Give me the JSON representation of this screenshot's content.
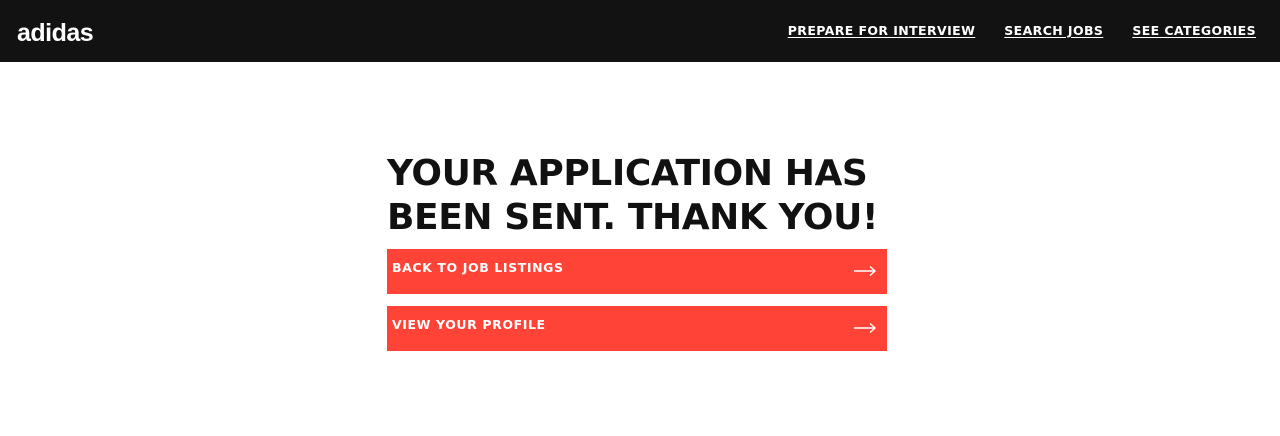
{
  "header": {
    "logo": "adidas",
    "nav": [
      {
        "label": "PREPARE FOR INTERVIEW"
      },
      {
        "label": "SEARCH JOBS"
      },
      {
        "label": "SEE CATEGORIES"
      }
    ]
  },
  "main": {
    "heading": "YOUR APPLICATION HAS BEEN SENT. THANK YOU!",
    "buttons": [
      {
        "label": "BACK TO JOB LISTINGS",
        "icon": "arrow-right-icon"
      },
      {
        "label": "VIEW YOUR PROFILE",
        "icon": "arrow-right-icon"
      }
    ]
  },
  "colors": {
    "header_bg": "#121212",
    "button_bg": "#ff4337",
    "heading_text": "#111111"
  }
}
